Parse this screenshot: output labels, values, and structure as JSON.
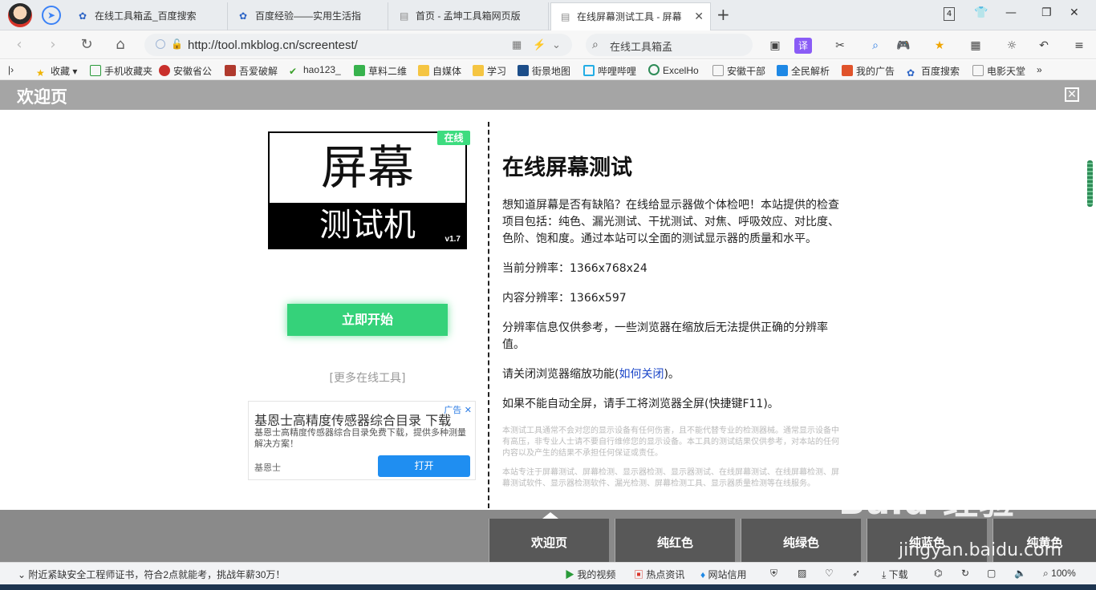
{
  "tabs": [
    {
      "label": "在线工具箱孟_百度搜索",
      "icon": "baidu-paw-icon"
    },
    {
      "label": "百度经验——实用生活指",
      "icon": "baidu-paw-icon"
    },
    {
      "label": "首页 - 孟坤工具箱网页版",
      "icon": "page-icon"
    },
    {
      "label": "在线屏幕测试工具 - 屏幕",
      "icon": "page-icon",
      "active": true
    }
  ],
  "tab_count": "4",
  "url": "http://tool.mkblog.cn/screentest/",
  "search_text": "在线工具箱孟",
  "bookmarks": [
    {
      "label": "收藏",
      "icon": "star-icon"
    },
    {
      "label": "手机收藏夹",
      "icon": "phone-icon"
    },
    {
      "label": "安徽省公",
      "icon": "emblem-icon"
    },
    {
      "label": "吾爱破解",
      "icon": "crack-icon"
    },
    {
      "label": "hao123_",
      "icon": "hao123-icon"
    },
    {
      "label": "草料二维",
      "icon": "qrcode-icon"
    },
    {
      "label": "自媒体",
      "icon": "folder-icon"
    },
    {
      "label": "学习",
      "icon": "folder-icon"
    },
    {
      "label": "街景地图",
      "icon": "map-icon"
    },
    {
      "label": "哔哩哔哩",
      "icon": "bilibili-icon"
    },
    {
      "label": "ExcelHo",
      "icon": "excel-icon"
    },
    {
      "label": "安徽干部",
      "icon": "page-icon"
    },
    {
      "label": "全民解析",
      "icon": "play-icon"
    },
    {
      "label": "我的广告",
      "icon": "ad-icon"
    },
    {
      "label": "百度搜索",
      "icon": "baidu-paw-icon"
    },
    {
      "label": "电影天堂",
      "icon": "page-icon"
    }
  ],
  "bookmarks_more": "»",
  "welcome": {
    "title": "欢迎页",
    "close": "✕"
  },
  "logo": {
    "top": "屏幕",
    "bottom": "测试机",
    "version": "v1.7",
    "badge": "在线"
  },
  "start_button": "立即开始",
  "more_tools": "[更多在线工具]",
  "ad": {
    "title": "基恩士高精度传感器综合目录 下载",
    "badge": "广告 ✕",
    "desc": "基恩士高精度传感器综合目录免费下载，提供多种测量解决方案！",
    "brand": "基恩士",
    "button": "打开"
  },
  "content": {
    "heading": "在线屏幕测试",
    "intro": "想知道屏幕是否有缺陷？在线给显示器做个体检吧！本站提供的检查项目包括：纯色、漏光测试、干扰测试、对焦、呼吸效应、对比度、色阶、饱和度。通过本站可以全面的测试显示器的质量和水平。",
    "resolution": "当前分辨率：1366x768x24",
    "content_resolution": "内容分辨率：1366x597",
    "note": "分辨率信息仅供参考，一些浏览器在缩放后无法提供正确的分辨率值。",
    "zoom_prefix": "请关闭浏览器缩放功能(",
    "zoom_link": "如何关闭",
    "zoom_suffix": ")。",
    "fullscreen": "如果不能自动全屏，请手工将浏览器全屏(快捷键F11)。",
    "fine1": "本测试工具通常不会对您的显示设备有任何伤害，且不能代替专业的检测器械。通常显示设备中有高压，非专业人士请不要自行维修您的显示设备。本工具的测试结果仅供参考，对本站的任何内容以及产生的结果不承担任何保证或责任。",
    "fine2": "本站专注于屏幕测试、屏幕检测、显示器检测、显示器测试、在线屏幕测试、在线屏幕检测、屏幕测试软件、显示器检测软件、漏光检测、屏幕检测工具、显示器质量检测等在线服务。"
  },
  "color_buttons": [
    "欢迎页",
    "纯红色",
    "纯绿色",
    "纯蓝色",
    "纯黄色"
  ],
  "watermark": {
    "brand": "Baid 经验",
    "url": "jingyan.baidu.com"
  },
  "status": {
    "news": "附近紧缺安全工程师证书，符合2点就能考，挑战年薪30万！",
    "video": "我的视频",
    "hot": "热点资讯",
    "credit": "网站信用",
    "download": "下载",
    "zoom": "100%"
  }
}
